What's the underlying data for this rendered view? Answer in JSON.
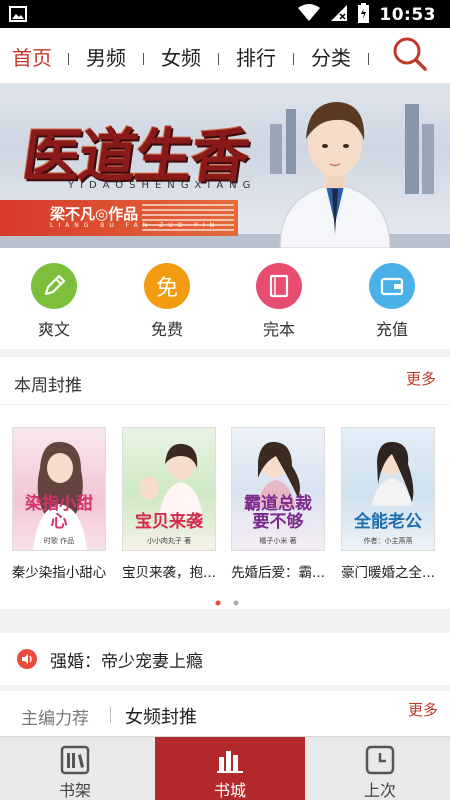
{
  "status_bar": {
    "time": "10:53"
  },
  "top_nav": {
    "tabs": [
      {
        "label": "首页",
        "active": true
      },
      {
        "label": "男频"
      },
      {
        "label": "女频"
      },
      {
        "label": "排行"
      },
      {
        "label": "分类"
      }
    ],
    "search_icon": "search-icon"
  },
  "banner": {
    "title": "医道生香",
    "pinyin": "YIDAOSHENGXIANG",
    "author": "梁不凡◎作品",
    "author_pinyin": "LIANG BU FAN ZUO PIN"
  },
  "categories": [
    {
      "label": "爽文",
      "icon": "pencil-icon",
      "color": "#7cbf3a"
    },
    {
      "label": "免费",
      "icon": "free-icon",
      "glyph": "免",
      "color": "#f39c12"
    },
    {
      "label": "完本",
      "icon": "book-icon",
      "color": "#e84d70"
    },
    {
      "label": "充值",
      "icon": "wallet-icon",
      "color": "#4ab0e8"
    }
  ],
  "weekly": {
    "title": "本周封推",
    "more": "更多",
    "books": [
      {
        "name": "秦少染指小甜心",
        "cover_title": "染指小甜心",
        "cover_author": "时歌 作品"
      },
      {
        "name": "宝贝来袭，抱...",
        "cover_title": "宝贝来袭",
        "cover_author": "小小肉丸子 著"
      },
      {
        "name": "先婚后爱：霸...",
        "cover_title": "霸道总裁要不够",
        "cover_author": "橘子小米 著"
      },
      {
        "name": "豪门暖婚之全...",
        "cover_title": "全能老公",
        "cover_author": "作者：小主燕燕"
      }
    ]
  },
  "notice": {
    "text": "强婚：帝少宠妻上瘾"
  },
  "recommend": {
    "tab1": "主编力荐",
    "tab2": "女频封推",
    "more": "更多"
  },
  "bottom_nav": [
    {
      "label": "书架",
      "icon": "bookshelf-icon"
    },
    {
      "label": "书城",
      "icon": "bookstore-icon",
      "active": true
    },
    {
      "label": "上次",
      "icon": "clock-icon"
    }
  ],
  "colors": {
    "accent": "#c0392b",
    "tab_active_bg": "#b3292a"
  }
}
